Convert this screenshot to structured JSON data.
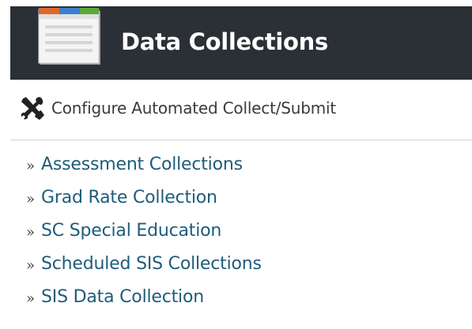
{
  "header": {
    "title": "Data Collections",
    "icon": "document-list-icon"
  },
  "config": {
    "label": "Configure Automated Collect/Submit",
    "icon": "tools-icon"
  },
  "links": {
    "bullet": "»",
    "items": [
      {
        "label": "Assessment Collections"
      },
      {
        "label": "Grad Rate Collection"
      },
      {
        "label": "SC Special Education"
      },
      {
        "label": "Scheduled SIS Collections"
      },
      {
        "label": "SIS Data Collection"
      }
    ]
  },
  "colors": {
    "header_bg": "#2b3036",
    "link": "#1f5c7a",
    "divider": "#c9d6e2"
  }
}
